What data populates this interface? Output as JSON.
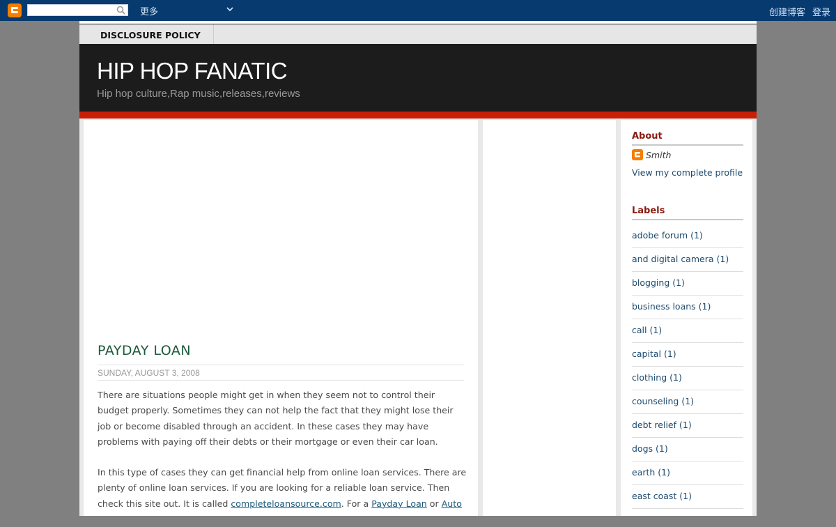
{
  "navbar": {
    "search_placeholder": "",
    "more_label": "更多",
    "create_blog": "创建博客",
    "sign_in": "登录"
  },
  "pages": {
    "tab_label": "DISCLOSURE POLICY"
  },
  "header": {
    "title": "HIP HOP FANATIC",
    "description": "Hip hop culture,Rap music,releases,reviews"
  },
  "post": {
    "title": "PAYDAY LOAN",
    "date": "SUNDAY, AUGUST 3, 2008",
    "para1": "There are situations people might get in when they seem not to control their budget properly. Sometimes they can not help the fact that they might lose their job or become disabled through an accident. In these cases they may have problems with paying off their debts or their mortgage or even their car loan.",
    "para2_pre": "In this type of cases they can get financial help from online loan services. There are plenty of online loan services. If you are looking for a reliable loan service. Then check this site out. It is called ",
    "link1": "completeloansource.com",
    "para2_mid": ". For a ",
    "link2": "Payday Loan",
    "para2_or": " or ",
    "link3": "Auto"
  },
  "sidebar": {
    "about_title": "About",
    "profile_name": "Smith",
    "profile_link": "View my complete profile",
    "labels_title": "Labels",
    "labels": [
      "adobe forum (1)",
      "and digital camera (1)",
      "blogging (1)",
      "business loans (1)",
      "call (1)",
      "capital (1)",
      "clothing (1)",
      "counseling (1)",
      "debt relief (1)",
      "dogs (1)",
      "earth (1)",
      "east coast (1)"
    ]
  },
  "colors": {
    "navbar": "#073a6e",
    "header": "#1c1c1c",
    "accent_red": "#c81f06",
    "post_title": "#1d5a3d",
    "widget_title": "#8b1a10",
    "link": "#1d4a6e"
  }
}
